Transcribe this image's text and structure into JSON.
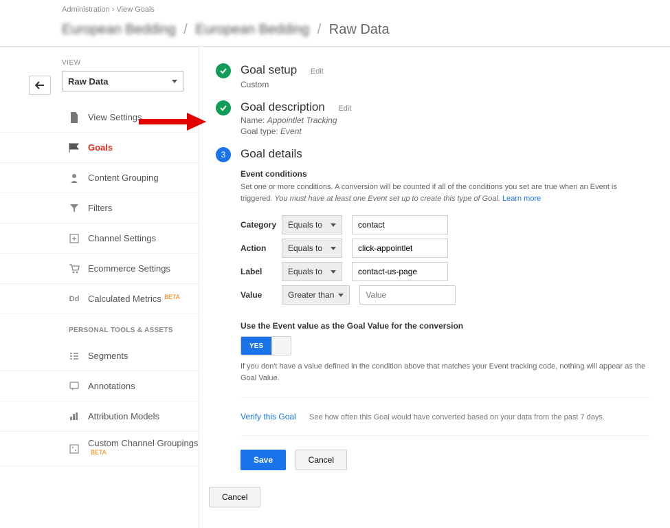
{
  "breadcrumb": {
    "admin": "Administration",
    "sep": "›",
    "view_goals": "View Goals"
  },
  "header": {
    "blur1": "European Bedding",
    "blur2": "European Bedding",
    "current": "Raw Data"
  },
  "sidebar": {
    "view_label": "VIEW",
    "selected_view": "Raw Data",
    "items": {
      "view_settings": "View Settings",
      "goals": "Goals",
      "content_grouping": "Content Grouping",
      "filters": "Filters",
      "channel_settings": "Channel Settings",
      "ecommerce_settings": "Ecommerce Settings",
      "calculated_metrics": "Calculated Metrics",
      "beta": "BETA"
    },
    "section2": "PERSONAL TOOLS & ASSETS",
    "items2": {
      "segments": "Segments",
      "annotations": "Annotations",
      "attribution_models": "Attribution Models",
      "custom_channel_groupings": "Custom Channel Groupings"
    }
  },
  "steps": {
    "setup": {
      "title": "Goal setup",
      "edit": "Edit",
      "sub": "Custom"
    },
    "desc": {
      "title": "Goal description",
      "edit": "Edit",
      "name_label": "Name:",
      "name_value": "Appointlet Tracking",
      "type_label": "Goal type:",
      "type_value": "Event"
    },
    "details": {
      "num": "3",
      "title": "Goal details",
      "event_conditions": "Event conditions",
      "help": "Set one or more conditions. A conversion will be counted if all of the conditions you set are true when an Event is triggered.",
      "help_italic": "You must have at least one Event set up to create this type of Goal.",
      "learn_more": "Learn more"
    }
  },
  "conditions": {
    "category": {
      "label": "Category",
      "op": "Equals to",
      "value": "contact"
    },
    "action": {
      "label": "Action",
      "op": "Equals to",
      "value": "click-appointlet"
    },
    "clabel": {
      "label": "Label",
      "op": "Equals to",
      "value": "contact-us-page"
    },
    "cvalue": {
      "label": "Value",
      "op": "Greater than",
      "placeholder": "Value"
    }
  },
  "usevalue": {
    "heading": "Use the Event value as the Goal Value for the conversion",
    "yes": "YES",
    "note": "If you don't have a value defined in the condition above that matches your Event tracking code, nothing will appear as the Goal Value."
  },
  "verify": {
    "link": "Verify this Goal",
    "text": "See how often this Goal would have converted based on your data from the past 7 days."
  },
  "buttons": {
    "save": "Save",
    "cancel": "Cancel",
    "outer_cancel": "Cancel"
  }
}
